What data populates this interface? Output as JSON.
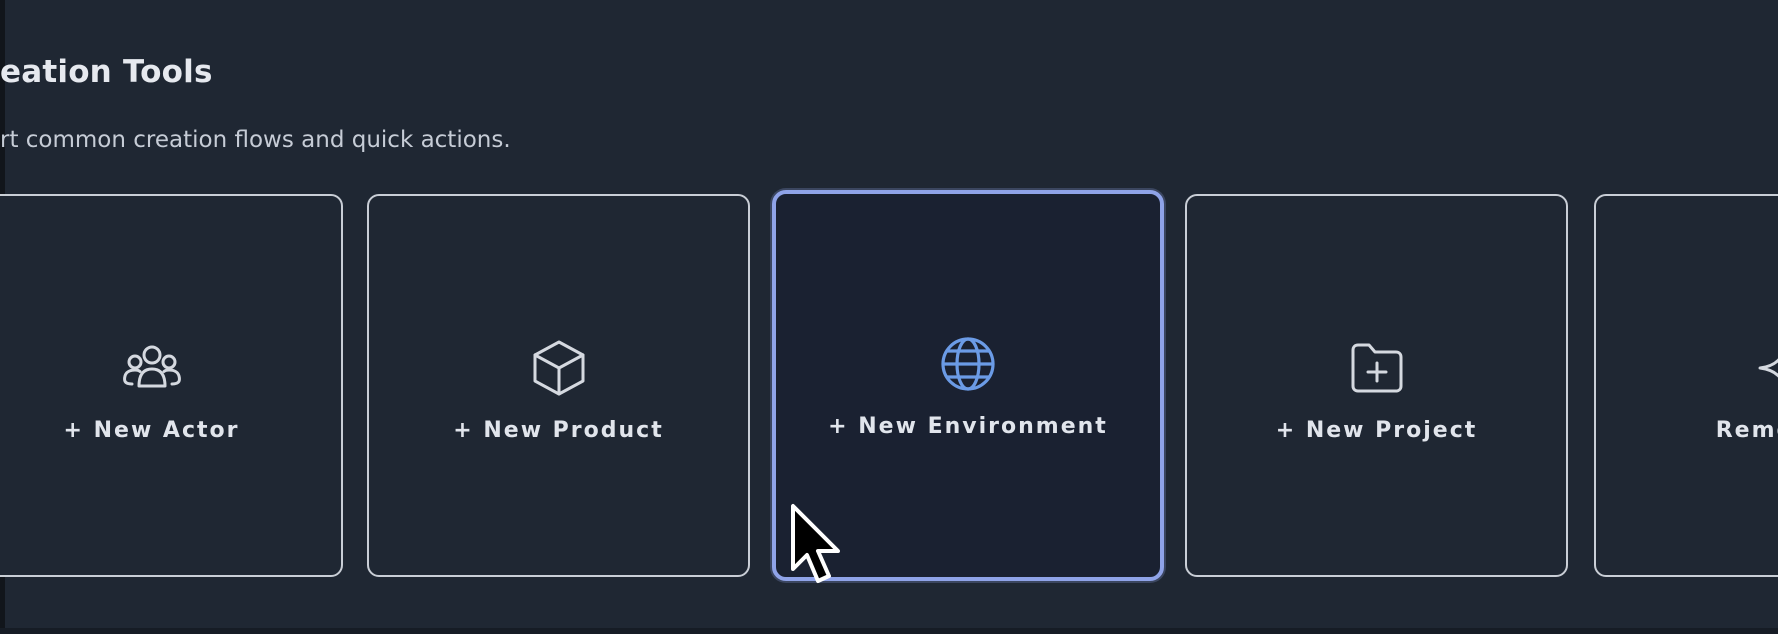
{
  "section": {
    "title": "eation Tools",
    "subtitle": "rt common creation flows and quick actions."
  },
  "cards": [
    {
      "label": "+ New Actor",
      "icon": "users-icon"
    },
    {
      "label": "+ New Product",
      "icon": "cube-icon"
    },
    {
      "label": "+ New Environment",
      "icon": "globe-icon",
      "state": "hovered"
    },
    {
      "label": "+ New Project",
      "icon": "folder-plus-icon"
    },
    {
      "label": "Remove B",
      "icon": "sparkle-icon"
    }
  ],
  "colors": {
    "background": "#1f2733",
    "card_border": "#c9ced6",
    "active_border": "#8fa3e8",
    "active_icon": "#6b9be6",
    "icon": "#d5d9e0",
    "text": "#e1e5ec"
  }
}
